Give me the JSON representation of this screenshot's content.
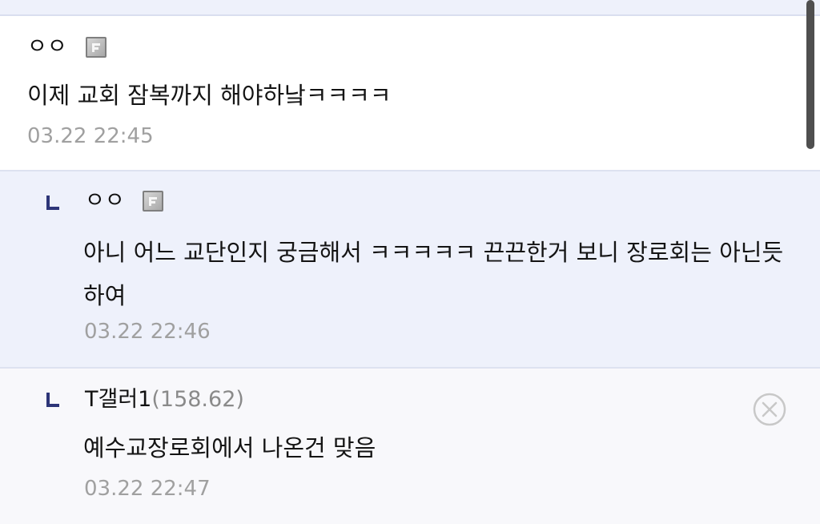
{
  "comments": [
    {
      "nickname": "ㅇㅇ",
      "badge_icon": "fixed-nick-icon",
      "body": "이제 교회 잠복까지 해야하낰ㅋㅋㅋㅋ",
      "timestamp": "03.22 22:45"
    },
    {
      "nickname": "ㅇㅇ",
      "badge_icon": "fixed-nick-icon",
      "reply_icon": "reply-arrow-icon",
      "body": "아니 어느 교단인지 궁금해서 ㅋㅋㅋㅋㅋ 끈끈한거 보니 장로회는 아닌듯 하여",
      "timestamp": "03.22 22:46"
    },
    {
      "nickname": "T갤러1",
      "ip": "(158.62)",
      "reply_icon": "reply-arrow-icon",
      "body": "예수교장로회에서 나온건 맞음",
      "timestamp": "03.22 22:47",
      "delete_icon": "close-circle-icon"
    }
  ],
  "colors": {
    "reply_bg": "#eef1fb",
    "reply_mark": "#2d3578",
    "timestamp": "#a0a0a0",
    "divider": "#dde2f0"
  }
}
